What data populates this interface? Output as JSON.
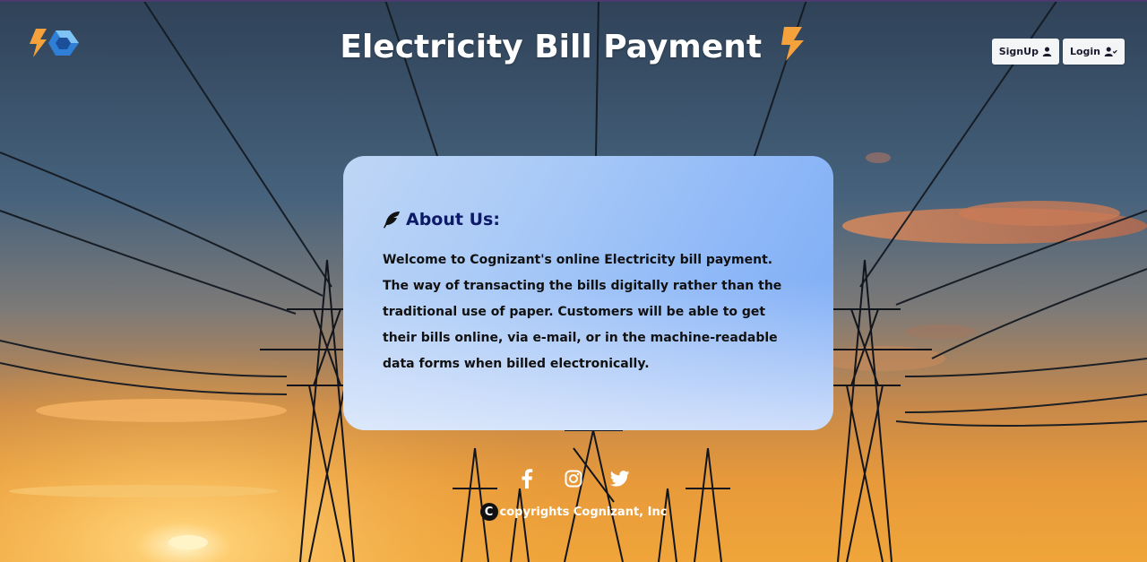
{
  "header": {
    "title": "Electricity Bill Payment",
    "logo_icon": "bolt-logo-icon",
    "signup_label": "SignUp",
    "login_label": "Login"
  },
  "about": {
    "heading": "About Us:",
    "icon": "feather-icon",
    "text": "Welcome to Cognizant's online Electricity bill payment. The way of transacting the bills digitally rather than the traditional use of paper. Customers will be able to get their bills online, via e-mail, or in the machine-readable data forms when billed electronically."
  },
  "footer": {
    "social": [
      "facebook-icon",
      "instagram-icon",
      "twitter-icon"
    ],
    "copyright_symbol": "C",
    "copyright_text": "copyrights Cognizant, Inc"
  },
  "colors": {
    "accent_bolt": "#f5a23c",
    "card_title": "#0d1a66",
    "card_start": "#bfd6f5",
    "card_end": "#7aaaf5"
  }
}
